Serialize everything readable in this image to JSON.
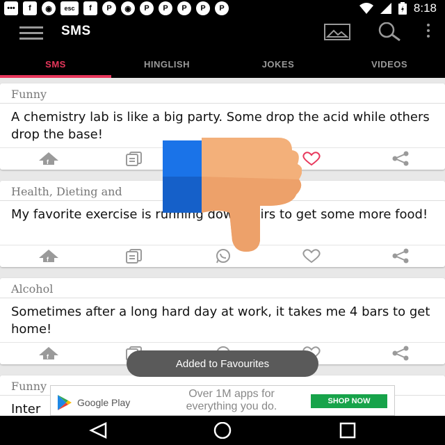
{
  "status_bar": {
    "time": "8:18",
    "notification_icons": [
      "chat-icon",
      "facebook-icon",
      "cat-icon",
      "esc-icon",
      "facebook-icon",
      "pinterest-icon",
      "cat-icon",
      "pinterest-icon",
      "pinterest-icon",
      "pinterest-icon",
      "pinterest-icon",
      "pinterest-icon"
    ],
    "esc_label": "esc"
  },
  "app_bar": {
    "title": "SMS",
    "icons": [
      "menu-icon",
      "image-icon",
      "search-icon",
      "more-vert-icon"
    ]
  },
  "tabs": [
    {
      "label": "SMS",
      "active": true
    },
    {
      "label": "HINGLISH",
      "active": false
    },
    {
      "label": "JOKES",
      "active": false
    },
    {
      "label": "VIDEOS",
      "active": false
    }
  ],
  "cards": [
    {
      "category": "Funny",
      "text": "A chemistry lab is like a big party. Some drop the acid while others drop the base!",
      "favourited": true
    },
    {
      "category": "Health, Dieting and",
      "text": "My favorite exercise is running downstairs to get some more food!",
      "favourited": false
    },
    {
      "category": "Alcohol",
      "text": "Sometimes after a long hard day at work, it takes me 4 bars to get home!",
      "favourited": false
    },
    {
      "category": "Funny",
      "text": "Inter",
      "favourited": false
    }
  ],
  "card_actions": [
    "share-facebook-icon",
    "copy-icon",
    "whatsapp-icon",
    "favourite-icon",
    "share-icon"
  ],
  "toast": "Added to Favourites",
  "ad": {
    "brand": "Google Play",
    "tagline": "Over 1M apps for everything you do.",
    "cta": "SHOP NOW"
  },
  "colors": {
    "accent": "#e8375c",
    "thumb": "#f3b07a",
    "cuff": "#1a73e8",
    "ad_button": "#17a34a"
  },
  "nav_bar": [
    "back-icon",
    "home-icon",
    "recents-icon"
  ]
}
